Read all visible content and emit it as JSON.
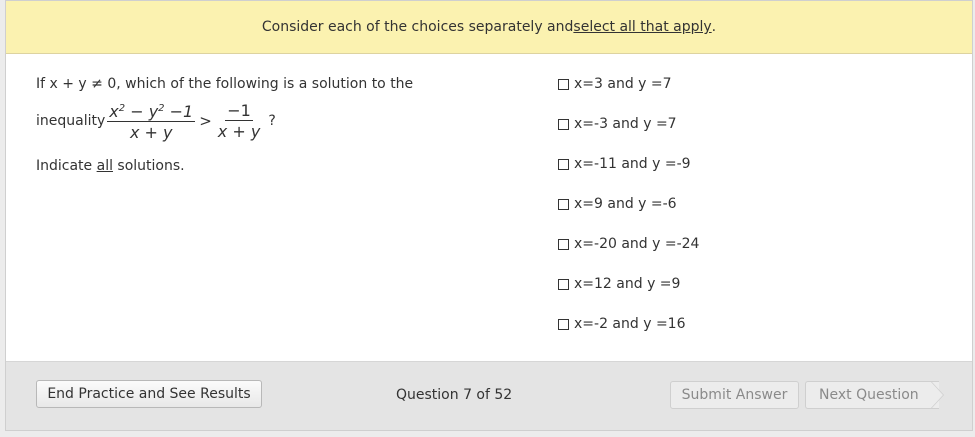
{
  "banner": {
    "text_before": "Consider each of the choices separately and ",
    "text_link": "select all that apply",
    "text_after": "."
  },
  "question": {
    "line1": "If x + y ≠ 0, which of the following is a solution to the",
    "line2_prefix": "inequality",
    "frac1_num": "x² − y² −1",
    "frac1_den": "x + y",
    "relation": ">",
    "frac2_num": "−1",
    "frac2_den": "x + y",
    "suffix": "?",
    "instruction_before": "Indicate ",
    "instruction_emph": "all",
    "instruction_after": " solutions."
  },
  "choices": [
    {
      "label": "x=3 and y =7",
      "checked": false
    },
    {
      "label": "x=-3 and y =7",
      "checked": false
    },
    {
      "label": "x=-11 and y =-9",
      "checked": false
    },
    {
      "label": "x=9 and y =-6",
      "checked": false
    },
    {
      "label": "x=-20 and y =-24",
      "checked": false
    },
    {
      "label": "x=12 and y =9",
      "checked": false
    },
    {
      "label": "x=-2 and y =16",
      "checked": false
    }
  ],
  "footer": {
    "end_label": "End Practice and See Results",
    "progress": "Question 7 of 52",
    "submit_label": "Submit Answer",
    "next_label": "Next Question"
  }
}
